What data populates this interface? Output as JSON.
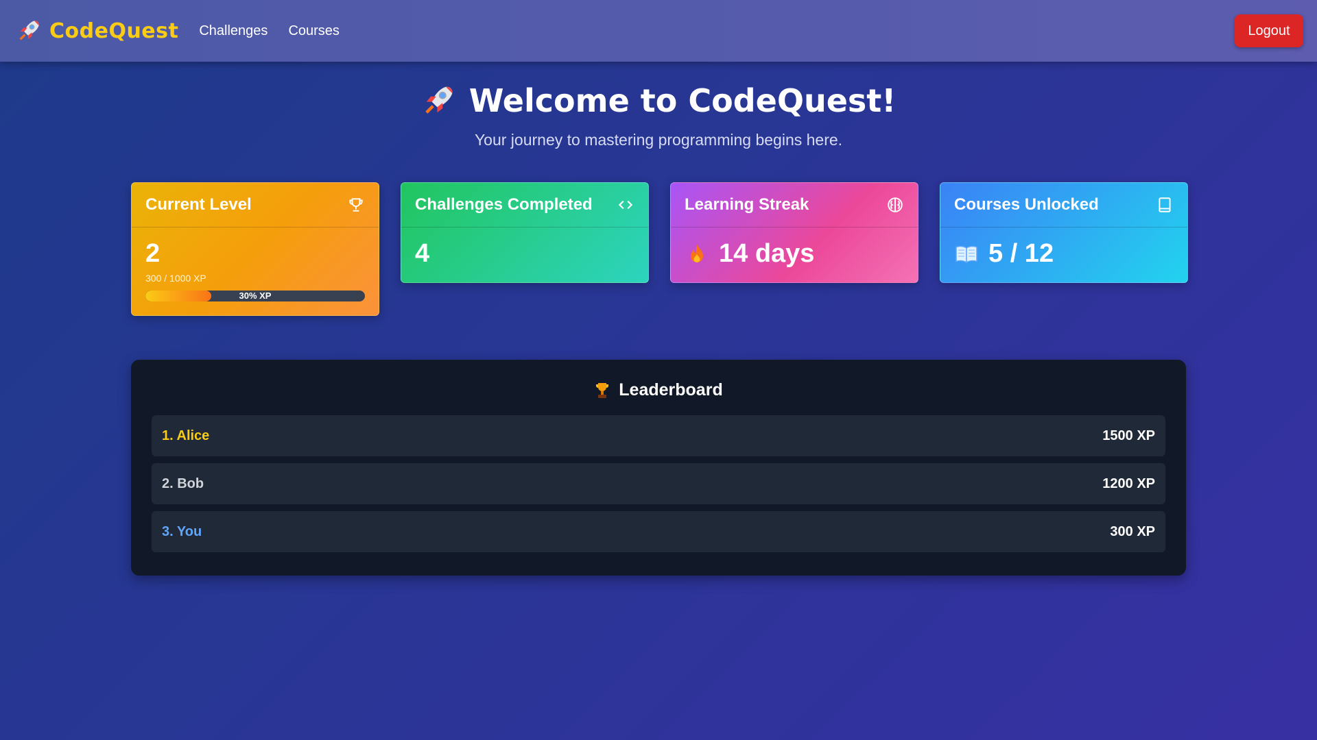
{
  "nav": {
    "brand": "CodeQuest",
    "brand_icon": "rocket-icon",
    "links": [
      "Challenges",
      "Courses"
    ],
    "logout": "Logout"
  },
  "hero": {
    "title": "Welcome to CodeQuest!",
    "subtitle": "Your journey to mastering programming begins here."
  },
  "cards": {
    "level": {
      "title": "Current Level",
      "value": "2",
      "xp": "300 / 1000 XP",
      "progress_label": "30% XP",
      "progress": 0.3,
      "icon": "trophy-icon"
    },
    "challenges": {
      "title": "Challenges Completed",
      "value": "4",
      "icon": "code-icon"
    },
    "streak": {
      "title": "Learning Streak",
      "value": "14 days",
      "icon": "brain-icon",
      "value_icon": "fire-icon"
    },
    "courses": {
      "title": "Courses Unlocked",
      "value": "5 / 12",
      "icon": "book-icon",
      "value_icon": "open-book-icon"
    }
  },
  "leaderboard": {
    "title": "Leaderboard",
    "icon": "trophy-icon",
    "rows": [
      {
        "name": "1. Alice",
        "xp": "1500 XP",
        "color": "#facc15"
      },
      {
        "name": "2. Bob",
        "xp": "1200 XP",
        "color": "#d1d5db"
      },
      {
        "name": "3. You",
        "xp": "300 XP",
        "color": "#60a5fa"
      }
    ]
  },
  "colors": {
    "brand": "#facc15",
    "logout": "#dc2626",
    "leaderboard_bg": "#111827"
  }
}
